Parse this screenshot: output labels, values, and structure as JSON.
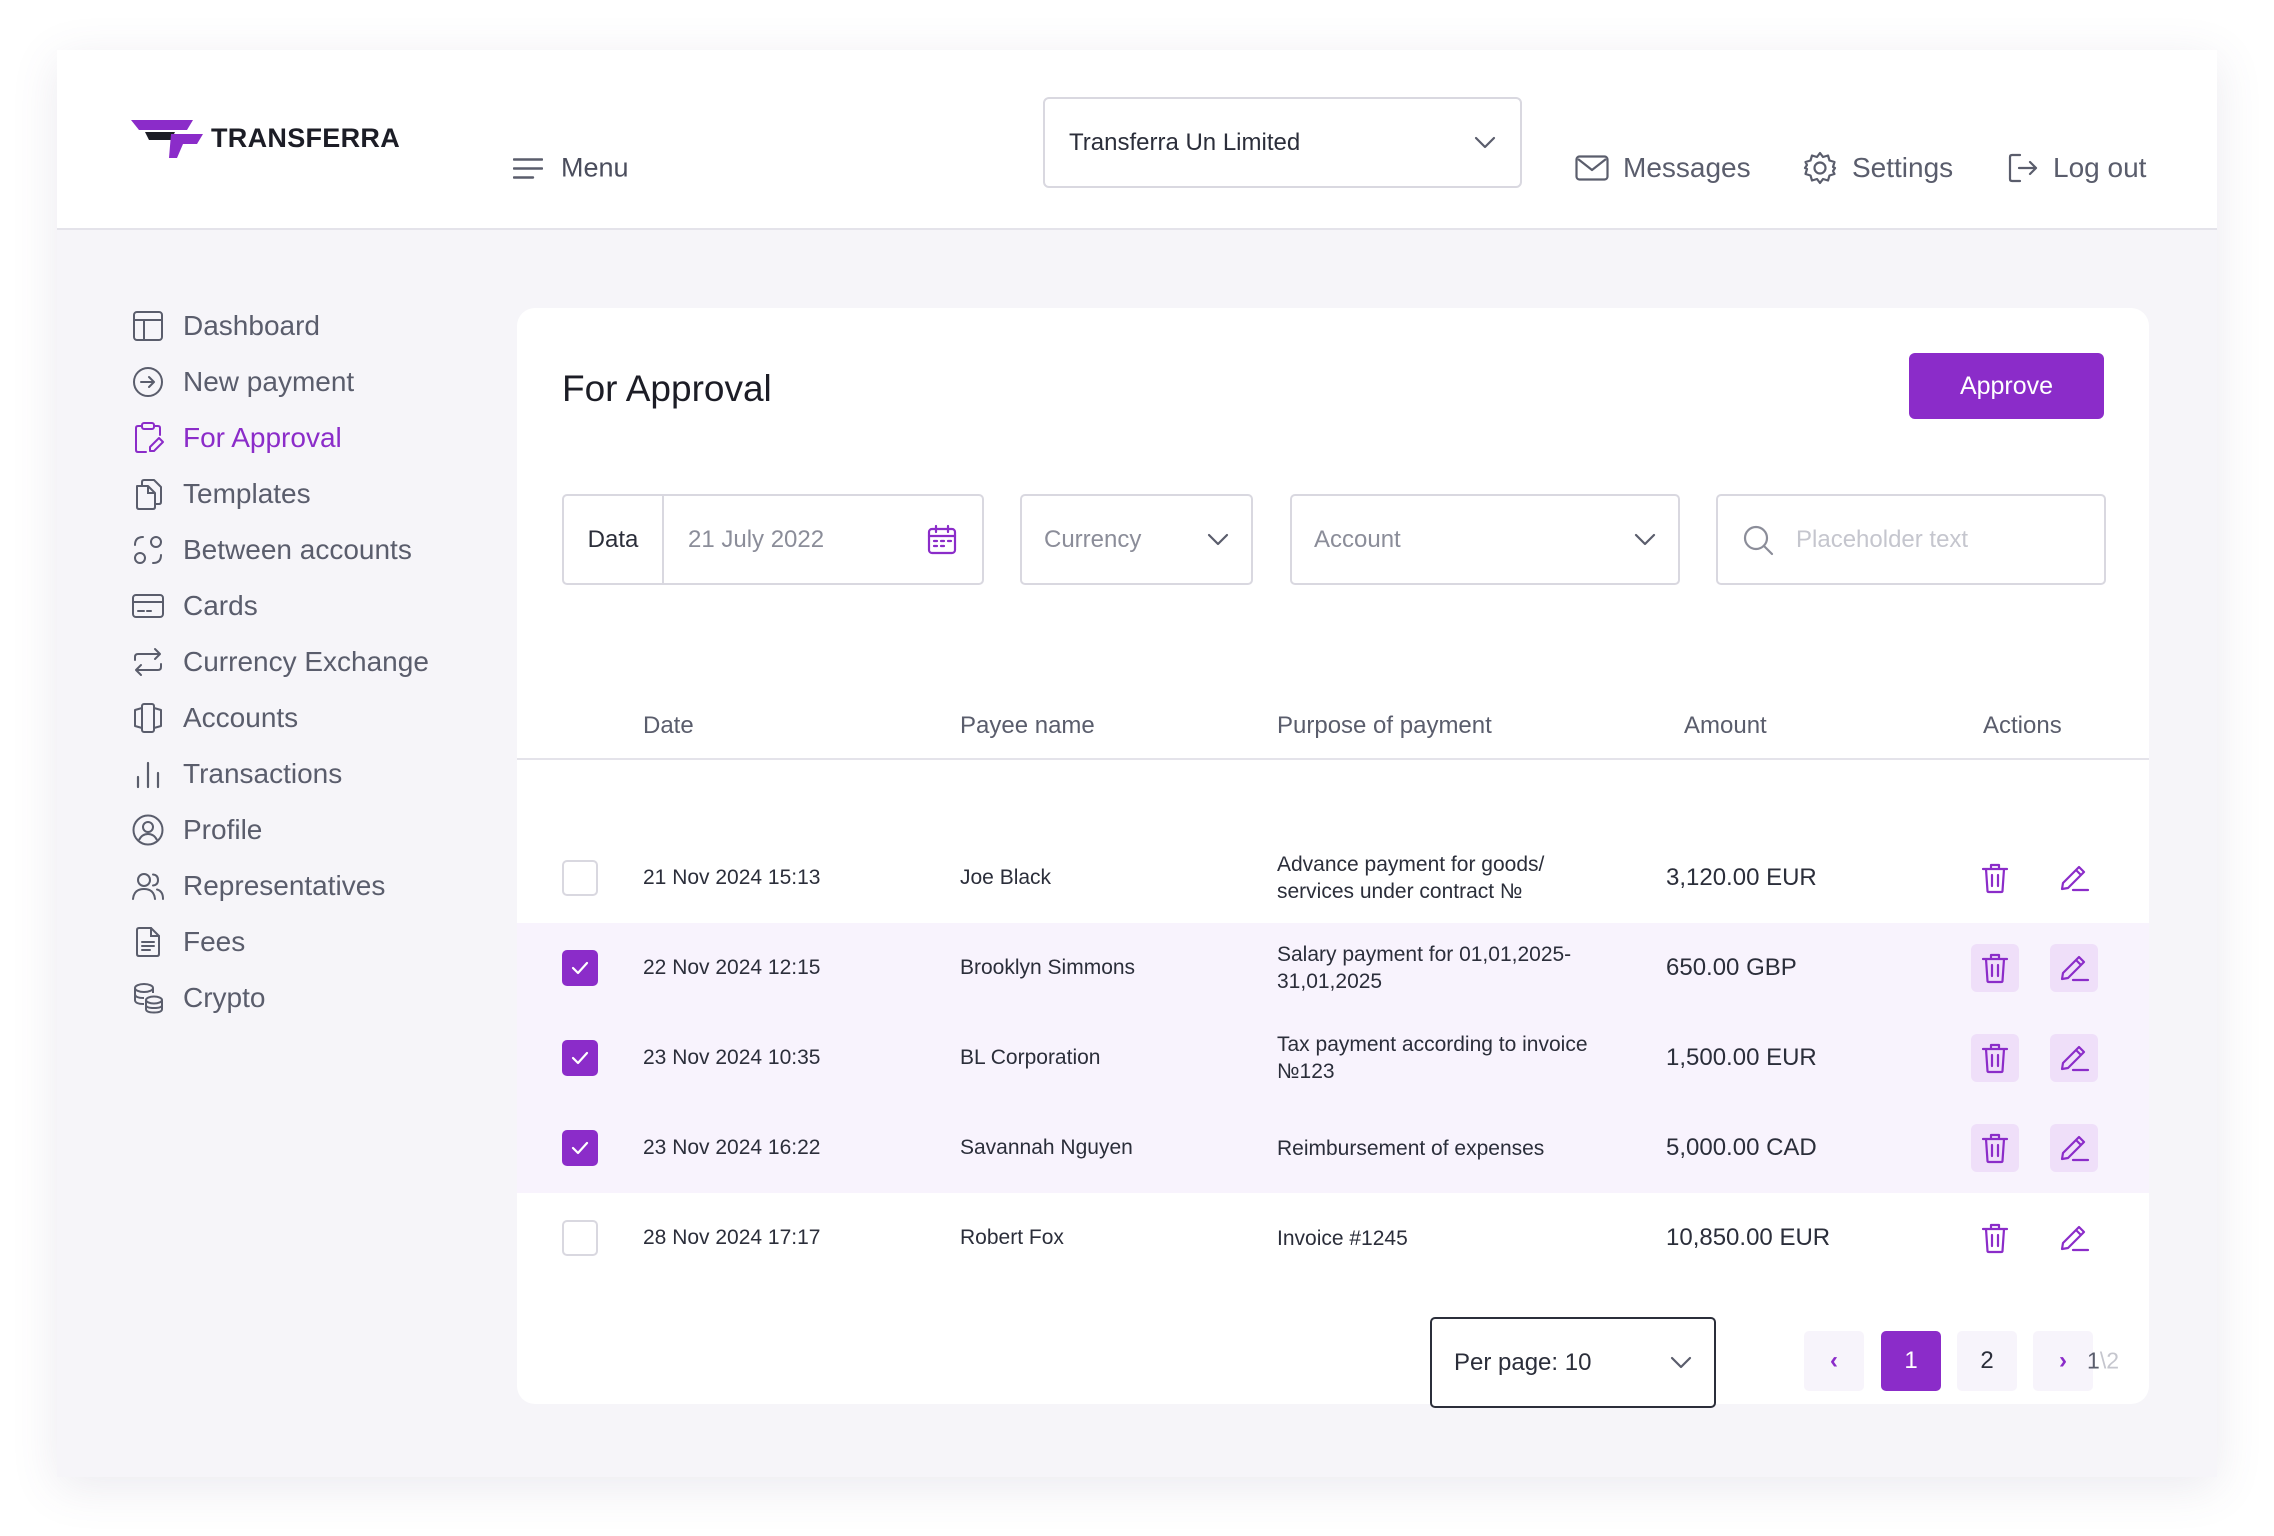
{
  "brand": {
    "name": "TRANSFERRA",
    "accent": "#8b2cc9"
  },
  "header": {
    "menu_label": "Menu",
    "company": "Transferra Un Limited",
    "messages_label": "Messages",
    "settings_label": "Settings",
    "logout_label": "Log out"
  },
  "sidebar": {
    "items": [
      {
        "label": "Dashboard",
        "icon": "dashboard-icon"
      },
      {
        "label": "New payment",
        "icon": "arrow-circle-icon"
      },
      {
        "label": "For Approval",
        "icon": "clipboard-edit-icon",
        "active": true
      },
      {
        "label": "Templates",
        "icon": "copy-icon"
      },
      {
        "label": "Between accounts",
        "icon": "transfer-shapes-icon"
      },
      {
        "label": "Cards",
        "icon": "card-icon"
      },
      {
        "label": "Currency Exchange",
        "icon": "repeat-icon"
      },
      {
        "label": "Accounts",
        "icon": "accounts-icon"
      },
      {
        "label": "Transactions",
        "icon": "bar-chart-icon"
      },
      {
        "label": "Profile",
        "icon": "user-circle-icon"
      },
      {
        "label": "Representatives",
        "icon": "users-icon"
      },
      {
        "label": "Fees",
        "icon": "document-icon"
      },
      {
        "label": "Crypto",
        "icon": "coins-icon"
      }
    ]
  },
  "main": {
    "title": "For Approval",
    "approve_label": "Approve",
    "filters": {
      "date_label": "Data",
      "date_value": "21 July 2022",
      "currency_placeholder": "Currency",
      "account_placeholder": "Account",
      "search_placeholder": "Placeholder text"
    },
    "table": {
      "columns": [
        "Date",
        "Payee name",
        "Purpose of payment",
        "Amount",
        "Actions"
      ],
      "rows": [
        {
          "date": "21 Nov 2024  15:13",
          "payee": "Joe Black",
          "purpose": "Advance payment for goods/ services under contract №",
          "amount": "3,120.00 EUR",
          "selected": false
        },
        {
          "date": "22 Nov 2024  12:15",
          "payee": "Brooklyn Simmons",
          "purpose": "Salary payment for 01,01,2025-31,01,2025",
          "amount": "650.00 GBP",
          "selected": true
        },
        {
          "date": "23 Nov 2024  10:35",
          "payee": "BL Corporation",
          "purpose": "Tax payment according to invoice №123",
          "amount": "1,500.00 EUR",
          "selected": true
        },
        {
          "date": "23 Nov 2024  16:22",
          "payee": "Savannah Nguyen",
          "purpose": "Reimbursement of expenses",
          "amount": "5,000.00 CAD",
          "selected": true
        },
        {
          "date": "28 Nov 2024  17:17",
          "payee": "Robert Fox",
          "purpose": "Invoice #1245",
          "amount": "10,850.00 EUR",
          "selected": false
        }
      ]
    },
    "pagination": {
      "per_page_label": "Per page: 10",
      "prev": "‹",
      "next": "›",
      "pages": [
        "1",
        "2"
      ],
      "current_page": "1",
      "count_current": "1",
      "count_sep": "\\",
      "count_total": "2"
    }
  }
}
